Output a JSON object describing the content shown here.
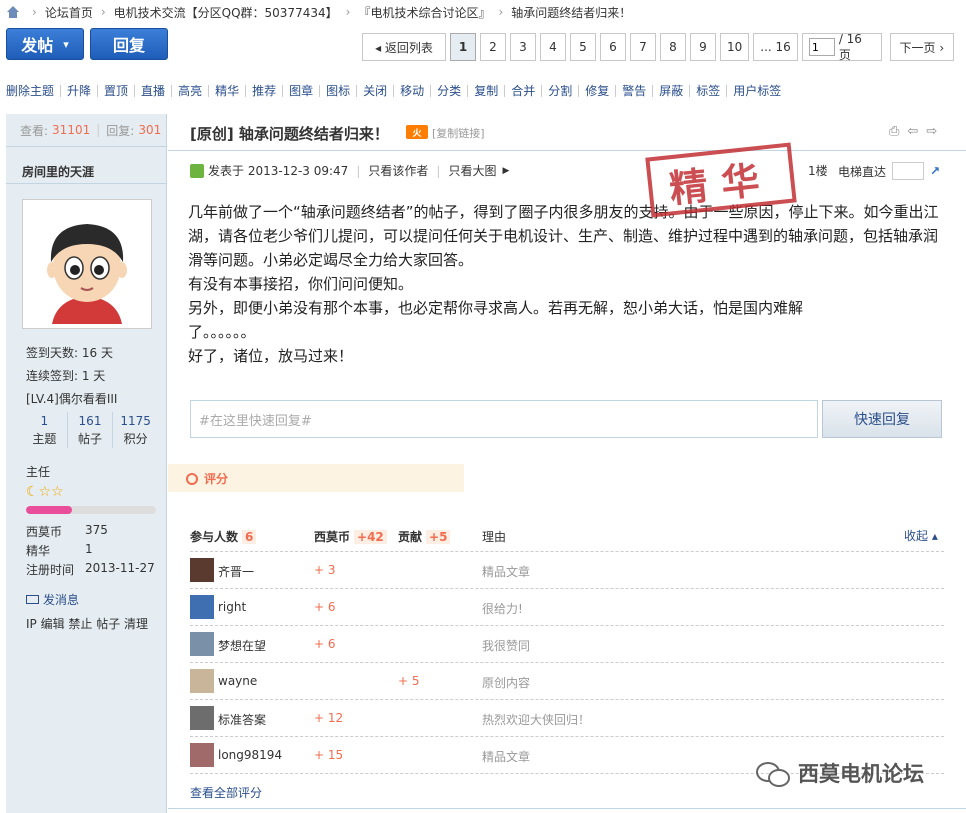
{
  "breadcrumb": {
    "items": [
      "论坛首页",
      "电机技术交流【分区QQ群：50377434】",
      "『电机技术综合讨论区』",
      "轴承问题终结者归来！"
    ],
    "separator": "›"
  },
  "toolbar": {
    "post_label": "发帖",
    "post_arrow": "▾",
    "reply_label": "回复"
  },
  "pager": {
    "back_label": "◂ 返回列表",
    "pages": [
      "1",
      "2",
      "3",
      "4",
      "5",
      "6",
      "7",
      "8",
      "9",
      "10"
    ],
    "current_page": "1",
    "ellipsis_last": "... 16",
    "page_input_value": "1",
    "total_label": "/ 16 页",
    "next_label": "下一页 ›"
  },
  "moderation": {
    "items": [
      "删除主题",
      "升降",
      "置顶",
      "直播",
      "高亮",
      "精华",
      "推荐",
      "图章",
      "图标",
      "关闭",
      "移动",
      "分类",
      "复制",
      "合并",
      "分割",
      "修复",
      "警告",
      "屏蔽",
      "标签",
      "用户标签"
    ]
  },
  "thread_stats": {
    "views_label": "查看:",
    "views": "31101",
    "replies_label": "回复:",
    "replies": "301"
  },
  "author": {
    "name": "房间里的天涯",
    "sign_days": "签到天数: 16 天",
    "streak": "连续签到: 1 天",
    "level": "[LV.4]偶尔看看III",
    "topics_value": "1",
    "topics_label": "主题",
    "posts_value": "161",
    "posts_label": "帖子",
    "credits_value": "1175",
    "credits_label": "积分",
    "rank": "主任",
    "rank_stars": "☾☆☆",
    "rank_progress": 0.35,
    "ximo_label": "西莫币",
    "ximo_value": "375",
    "jinghua_label": "精华",
    "jinghua_value": "1",
    "regtime_label": "注册时间",
    "regtime_value": "2013-11-27",
    "message_label": "发消息",
    "admin_links": "IP 编辑 禁止 帖子 清理"
  },
  "post": {
    "title": "[原创] 轴承问题终结者归来！",
    "hot_badge": "火",
    "copy_link": "[复制链接]",
    "posted_at": "发表于 2013-12-3 09:47",
    "only_author": "只看该作者",
    "big_image": "只看大图",
    "floor": "1楼",
    "elevator_label": "电梯直达",
    "stamp_text": "精华",
    "paragraphs": [
      "几年前做了一个“轴承问题终结者”的帖子，得到了圈子内很多朋友的支持。由于一些原因，停止下来。如今重出江湖，请各位老少爷们儿提问，可以提问任何关于电机设计、生产、制造、维护过程中遇到的轴承问题，包括轴承润滑等问题。小弟必定竭尽全力给大家回答。",
      "有没有本事接招，你们问问便知。",
      "另外，即便小弟没有那个本事，也必定帮你寻求高人。若再无解，恕小弟大话，怕是国内难解了。。。。。。",
      "好了，诸位，放马过来！"
    ]
  },
  "quick_reply": {
    "placeholder": "#在这里快速回复#",
    "button": "快速回复"
  },
  "rating": {
    "tab_label": "评分",
    "col_people": "参与人数",
    "people_count": "6",
    "col_ximo": "西莫币",
    "ximo_total": "+42",
    "col_gongxian": "贡献",
    "gongxian_total": "+5",
    "col_reason": "理由",
    "collapse_label": "收起 ▴",
    "rows": [
      {
        "name": "齐晋一",
        "ximo": "+ 3",
        "gongxian": "",
        "reason": "精品文章",
        "avatar_color": "#5a3a2e"
      },
      {
        "name": "right",
        "ximo": "+ 6",
        "gongxian": "",
        "reason": "很给力!",
        "avatar_color": "#3f6fb0"
      },
      {
        "name": "梦想在望",
        "ximo": "+ 6",
        "gongxian": "",
        "reason": "我很赞同",
        "avatar_color": "#7a8fa8"
      },
      {
        "name": "wayne",
        "ximo": "",
        "gongxian": "+ 5",
        "reason": "原创内容",
        "avatar_color": "#c9b59a"
      },
      {
        "name": "标准答案",
        "ximo": "+ 12",
        "gongxian": "",
        "reason": "热烈欢迎大侠回归！",
        "avatar_color": "#6d6d6d"
      },
      {
        "name": "long98194",
        "ximo": "+ 15",
        "gongxian": "",
        "reason": "精品文章",
        "avatar_color": "#a06a6a"
      }
    ],
    "view_all": "查看全部评分"
  },
  "watermark": {
    "text": "西莫电机论坛"
  }
}
